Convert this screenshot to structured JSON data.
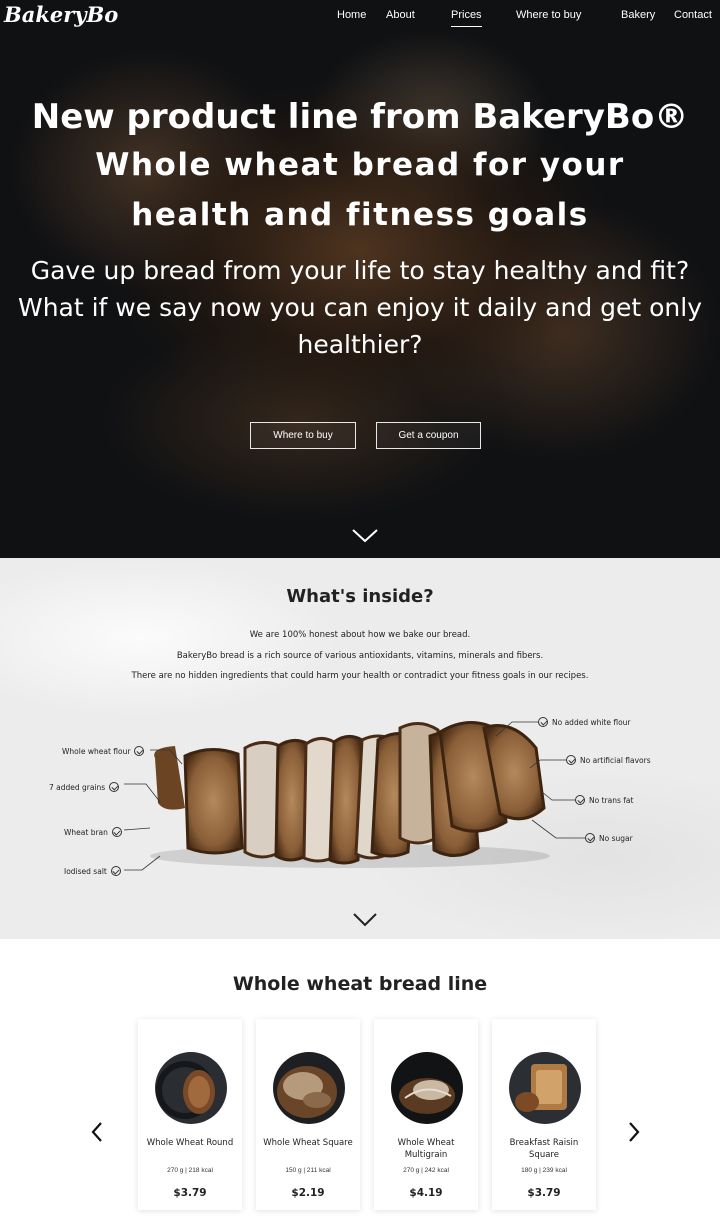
{
  "nav": {
    "logo": "BakeryBo",
    "items": [
      "Home",
      "About",
      "Prices",
      "Where to buy",
      "Bakery",
      "Contact"
    ],
    "active": "Prices"
  },
  "hero": {
    "title": "New product line from BakeryBo®",
    "subtitle": "Whole wheat bread for your health and fitness goals",
    "question_1": "Gave up bread from your life to stay healthy and fit?",
    "question_2": "What if we say now you can enjoy it daily and get only healthier?",
    "btn_where": "Where to buy",
    "btn_coupon": "Get a coupon",
    "scroll_icon": "chevron-down-icon"
  },
  "inside": {
    "title": "What's inside?",
    "line1": "We are 100% honest about how we bake our bread.",
    "line2": "BakeryBo bread is a rich source of various antioxidants, vitamins, minerals and fibers.",
    "line3": "There are no hidden ingredients that could harm your health or contradict your fitness goals in our recipes.",
    "left_ingredients": [
      "Whole wheat flour",
      "7 added grains",
      "Wheat bran",
      "Iodised salt"
    ],
    "right_ingredients": [
      "No added white flour",
      "No artificial flavors",
      "No trans fat",
      "No sugar"
    ]
  },
  "products": {
    "title": "Whole wheat bread line",
    "prev_icon": "chevron-left-icon",
    "next_icon": "chevron-right-icon",
    "cards": [
      {
        "name": "Whole Wheat Round",
        "meta": "270 g | 218 kcal",
        "price": "$3.79"
      },
      {
        "name": "Whole Wheat Square",
        "meta": "150 g | 211 kcal",
        "price": "$2.19"
      },
      {
        "name": "Whole Wheat Multigrain",
        "meta": "270 g | 242 kcal",
        "price": "$4.19"
      },
      {
        "name": "Breakfast Raisin Square",
        "meta": "180 g | 239 kcal",
        "price": "$3.79"
      }
    ]
  },
  "colors": {
    "hero_dark": "#15171a",
    "paper": "#ececec",
    "text": "#222222",
    "white": "#ffffff"
  }
}
